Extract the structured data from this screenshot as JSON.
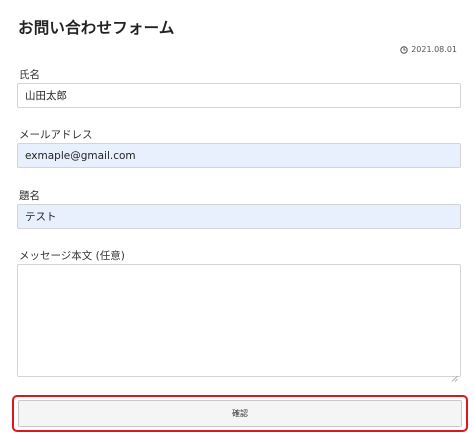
{
  "page": {
    "title": "お問い合わせフォーム",
    "date": "2021.08.01",
    "date_icon": "clock-icon"
  },
  "form": {
    "name": {
      "label": "氏名",
      "value": "山田太郎"
    },
    "email": {
      "label": "メールアドレス",
      "value": "exmaple@gmail.com"
    },
    "subject": {
      "label": "題名",
      "value": "テスト"
    },
    "message": {
      "label": "メッセージ本文 (任意)",
      "value": ""
    },
    "submit_label": "確認"
  },
  "colors": {
    "autofill_background": "#e8f0fe",
    "highlight_border": "#e0141e",
    "button_background": "#f5f5f5"
  }
}
